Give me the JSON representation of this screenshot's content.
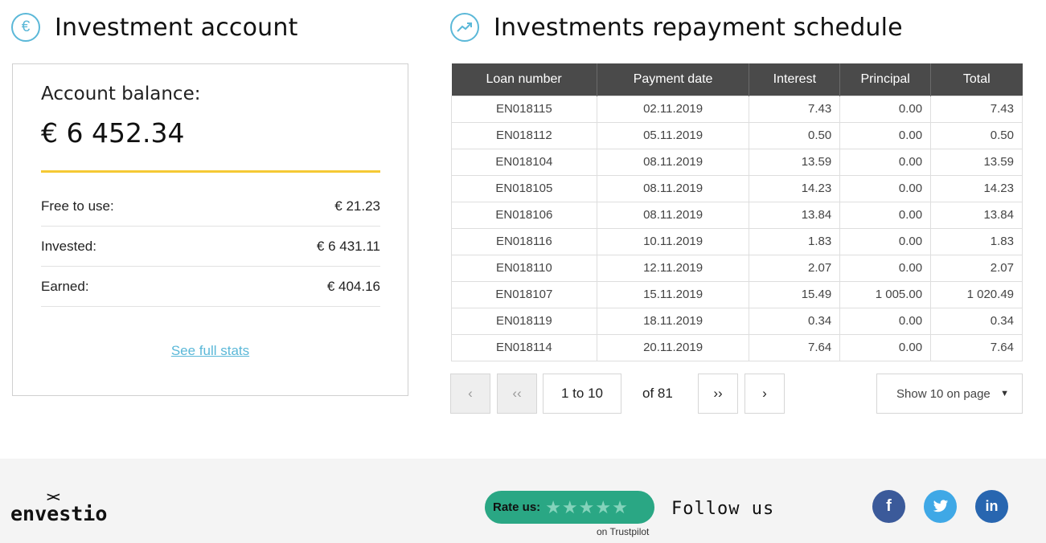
{
  "left_section": {
    "title": "Investment account",
    "icon": "euro-icon",
    "icon_glyph": "€"
  },
  "right_section": {
    "title": "Investments repayment schedule",
    "icon": "trend-up-icon"
  },
  "account": {
    "balance_label": "Account balance:",
    "balance_value": "€ 6 452.34",
    "stats": [
      {
        "label": "Free to use:",
        "value": "€ 21.23"
      },
      {
        "label": "Invested:",
        "value": "€ 6 431.11"
      },
      {
        "label": "Earned:",
        "value": "€ 404.16"
      }
    ],
    "see_stats_link": "See full stats",
    "accent_color": "#f5c934"
  },
  "schedule": {
    "columns": [
      "Loan number",
      "Payment date",
      "Interest",
      "Principal",
      "Total"
    ],
    "rows": [
      [
        "EN018115",
        "02.11.2019",
        "7.43",
        "0.00",
        "7.43"
      ],
      [
        "EN018112",
        "05.11.2019",
        "0.50",
        "0.00",
        "0.50"
      ],
      [
        "EN018104",
        "08.11.2019",
        "13.59",
        "0.00",
        "13.59"
      ],
      [
        "EN018105",
        "08.11.2019",
        "14.23",
        "0.00",
        "14.23"
      ],
      [
        "EN018106",
        "08.11.2019",
        "13.84",
        "0.00",
        "13.84"
      ],
      [
        "EN018116",
        "10.11.2019",
        "1.83",
        "0.00",
        "1.83"
      ],
      [
        "EN018110",
        "12.11.2019",
        "2.07",
        "0.00",
        "2.07"
      ],
      [
        "EN018107",
        "15.11.2019",
        "15.49",
        "1 005.00",
        "1 020.49"
      ],
      [
        "EN018119",
        "18.11.2019",
        "0.34",
        "0.00",
        "0.34"
      ],
      [
        "EN018114",
        "20.11.2019",
        "7.64",
        "0.00",
        "7.64"
      ]
    ]
  },
  "pagination": {
    "prev": "‹",
    "first": "‹‹",
    "range": "1 to 10",
    "of_total": "of 81",
    "last": "››",
    "next": "›",
    "page_size": "Show 10 on page"
  },
  "footer": {
    "logo_mark": "><",
    "logo_text": "envestio",
    "rate_label": "Rate us:",
    "trustpilot": "on Trustpilot",
    "follow": "Follow us",
    "social": [
      {
        "name": "facebook-icon",
        "glyph": "f"
      },
      {
        "name": "twitter-icon",
        "glyph": "t"
      },
      {
        "name": "linkedin-icon",
        "glyph": "in"
      }
    ],
    "rate_color": "#2aa784"
  }
}
